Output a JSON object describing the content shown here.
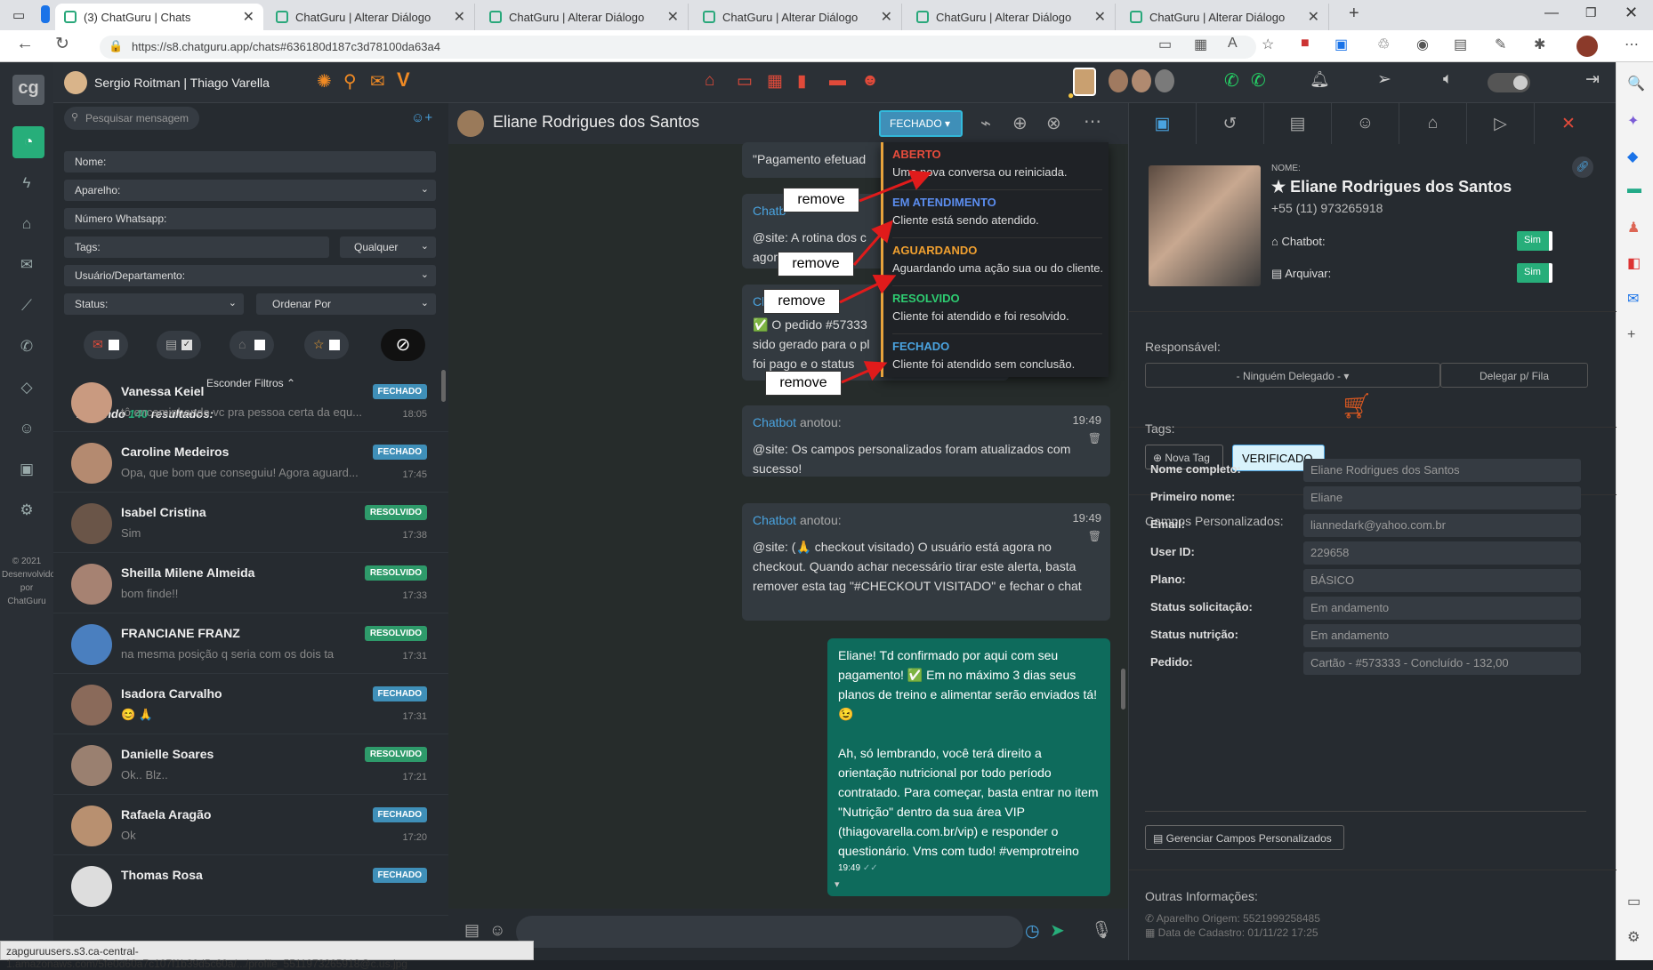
{
  "browser": {
    "tabs": [
      {
        "title": "(3) ChatGuru | Chats"
      },
      {
        "title": "ChatGuru | Alterar Diálogo"
      },
      {
        "title": "ChatGuru | Alterar Diálogo"
      },
      {
        "title": "ChatGuru | Alterar Diálogo"
      },
      {
        "title": "ChatGuru | Alterar Diálogo"
      },
      {
        "title": "ChatGuru | Alterar Diálogo"
      }
    ],
    "url": "https://s8.chatguru.app/chats#636180d187c3d78100da63a4",
    "status_url": "zapguruusers.s3.ca-central-1.amazonaws.com/5fe0d60a7c107f1b39d5c60a/.../profile_5511973265918@c.us.jpg"
  },
  "header": {
    "user": "Sergio Roitman | Thiago Varella"
  },
  "leftnav": {
    "logo": "cg",
    "footer": "© 2021 Desenvolvido por ChatGuru"
  },
  "list": {
    "search_placeholder": "Pesquisar mensagem",
    "filters": {
      "nome": "Nome:",
      "aparelho": "Aparelho:",
      "numero": "Número Whatsapp:",
      "tags": "Tags:",
      "qualquer": "Qualquer",
      "usuario": "Usuário/Departamento:",
      "status": "Status:",
      "ordenar": "Ordenar Por"
    },
    "hide_filters": "Esconder Filtros ⌃",
    "results_prefix": "Exibindo",
    "results_count": "140",
    "results_suffix": "resultados:",
    "chats": [
      {
        "name": "Vanessa Keiel",
        "preview": "tô encaminhando vc pra pessoa certa da equ...",
        "status": "FECHADO",
        "time": "18:05"
      },
      {
        "name": "Caroline Medeiros",
        "preview": "Opa, que bom que conseguiu! Agora aguard...",
        "status": "FECHADO",
        "time": "17:45"
      },
      {
        "name": "Isabel Cristina",
        "preview": "Sim",
        "status": "RESOLVIDO",
        "time": "17:38"
      },
      {
        "name": "Sheilla Milene Almeida",
        "preview": "bom finde!!",
        "status": "RESOLVIDO",
        "time": "17:33"
      },
      {
        "name": "FRANCIANE FRANZ",
        "preview": "na mesma posição q seria com os dois ta",
        "status": "RESOLVIDO",
        "time": "17:31"
      },
      {
        "name": "Isadora Carvalho",
        "preview": "😊 🙏",
        "status": "FECHADO",
        "time": "17:31"
      },
      {
        "name": "Danielle Soares",
        "preview": "Ok.. Blz..",
        "status": "RESOLVIDO",
        "time": "17:21"
      },
      {
        "name": "Rafaela Aragão",
        "preview": "Ok",
        "status": "FECHADO",
        "time": "17:20"
      },
      {
        "name": "Thomas Rosa",
        "preview": "",
        "status": "FECHADO",
        "time": ""
      }
    ]
  },
  "conversation": {
    "contact": "Eliane Rodrigues dos Santos",
    "status_button": "FECHADO",
    "msg0": "\"Pagamento efetuad",
    "msg1_who": "Chatb",
    "msg1_text": "@site: A rotina dos c agora",
    "msg2_who": "Ch",
    "msg2_text": "✅ O pedido #57333 sido gerado para o pl foi pago e o status",
    "msg3_who": "Chatbot",
    "msg3_action": "anotou:",
    "msg3_time": "19:49",
    "msg3_text": "@site: Os campos personalizados foram atualizados com sucesso!",
    "msg4_who": "Chatbot",
    "msg4_action": "anotou:",
    "msg4_time": "19:49",
    "msg4_text": "@site: (🙏 checkout visitado) O usuário está agora no checkout. Quando achar necessário tirar este alerta, basta remover esta tag \"#CHECKOUT VISITADO\" e fechar o chat",
    "msg5_text1": "Eliane! Td confirmado por aqui com seu pagamento! ✅ Em no máximo 3 dias seus planos de treino e alimentar serão enviados tá! 😉",
    "msg5_text2": "Ah, só lembrando, você terá direito a orientação nutricional por todo período contratado. Para começar, basta entrar no item \"Nutrição\" dentro da sua área VIP (thiagovarella.com.br/vip) e responder o questionário. Vms com tudo! #vemprotreino",
    "msg5_time": "19:49"
  },
  "dropdown": {
    "items": [
      {
        "label": "ABERTO",
        "desc": "Uma nova conversa ou reiniciada.",
        "color": "#e74c3c"
      },
      {
        "label": "EM ATENDIMENTO",
        "desc": "Cliente está sendo atendido.",
        "color": "#5b8def"
      },
      {
        "label": "AGUARDANDO",
        "desc": "Aguardando uma ação sua ou do cliente.",
        "color": "#f0a030"
      },
      {
        "label": "RESOLVIDO",
        "desc": "Cliente foi atendido e foi resolvido.",
        "color": "#2ecc71"
      },
      {
        "label": "FECHADO",
        "desc": "Cliente foi atendido sem conclusão.",
        "color": "#4aa3df"
      }
    ],
    "remove_label": "remove"
  },
  "profile": {
    "name_label": "NOME:",
    "name": "★ Eliane Rodrigues dos Santos",
    "phone": "+55 (11) 973265918",
    "chatbot_label": "Chatbot:",
    "chatbot_value": "Sim",
    "arquivar_label": "Arquivar:",
    "arquivar_value": "Sim",
    "responsavel_label": "Responsável:",
    "responsavel_value": "- Ninguém Delegado -",
    "delegar": "Delegar p/ Fila",
    "tags_label": "Tags:",
    "nova_tag": "Nova Tag",
    "tag": "VERIFICADO",
    "campos_title": "Campos Personalizados:",
    "fields": [
      {
        "label": "Nome completo:",
        "value": "Eliane Rodrigues dos Santos"
      },
      {
        "label": "Primeiro nome:",
        "value": "Eliane"
      },
      {
        "label": "Email:",
        "value": "liannedark@yahoo.com.br"
      },
      {
        "label": "User ID:",
        "value": "229658"
      },
      {
        "label": "Plano:",
        "value": "BÁSICO"
      },
      {
        "label": "Status solicitação:",
        "value": "Em andamento"
      },
      {
        "label": "Status nutrição:",
        "value": "Em andamento"
      },
      {
        "label": "Pedido:",
        "value": "Cartão - #573333 - Concluído - 132,00"
      }
    ],
    "gerenciar": "Gerenciar Campos Personalizados",
    "outras_title": "Outras Informações:",
    "aparelho_origem": "Aparelho Origem: 5521999258485",
    "data_cadastro": "Data de Cadastro: 01/11/22 17:25"
  },
  "colors": {
    "fechado": "#3f8fb8",
    "resolvido": "#2e9a6a",
    "accent": "#e04a3a",
    "whatsapp": "#25d366"
  }
}
